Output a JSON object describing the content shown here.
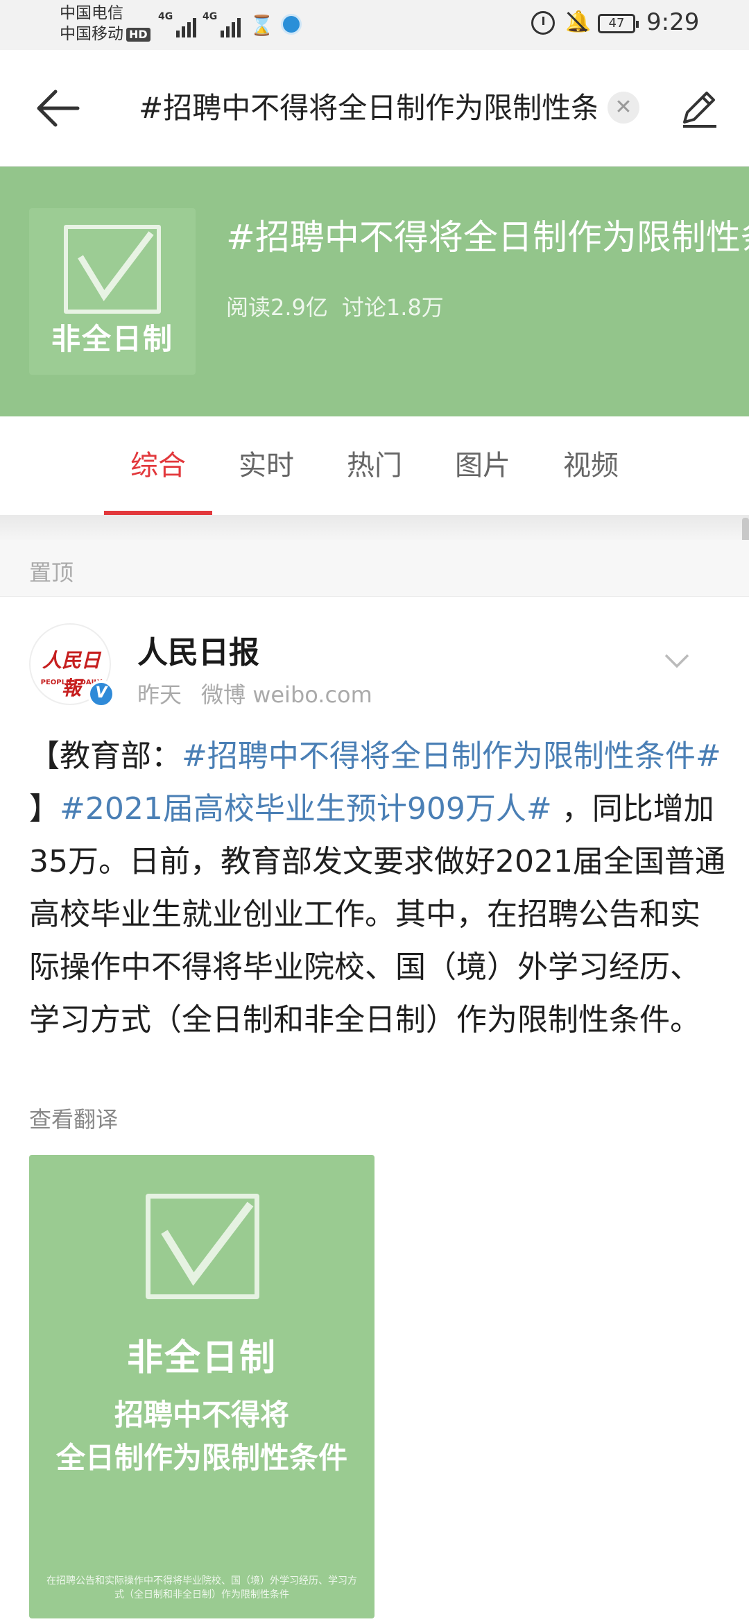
{
  "status_bar": {
    "carrier1": "中国电信",
    "carrier2": "中国移动",
    "hd": "HD",
    "net1": "4G",
    "net2": "4G",
    "battery": "47",
    "time": "9:29"
  },
  "header": {
    "search_query": "#招聘中不得将全日制作为限制性条件#",
    "clear_icon": "close-icon",
    "edit_icon": "pencil-icon",
    "back_icon": "arrow-left-icon"
  },
  "topic": {
    "thumb_label": "非全日制",
    "title": "#招聘中不得将全日制作为限制性条件#",
    "reads": "阅读2.9亿",
    "discussions": "讨论1.8万",
    "banner_color": "#93c58b"
  },
  "tabs": [
    {
      "label": "综合",
      "active": true
    },
    {
      "label": "实时",
      "active": false
    },
    {
      "label": "热门",
      "active": false
    },
    {
      "label": "图片",
      "active": false
    },
    {
      "label": "视频",
      "active": false
    }
  ],
  "accent_color": "#e2383c",
  "pinned_label": "置顶",
  "post": {
    "avatar_logo": "人民日報",
    "avatar_sub": "PEOPLE'S DAILY",
    "verified_badge": "V",
    "author": "人民日报",
    "time": "昨天",
    "source": "微博 weibo.com",
    "body_prefix": "【教育部：",
    "tag1": "#招聘中不得将全日制作为限制性条件#",
    "mid": " 】",
    "tag2": "#2021届高校毕业生预计909万人#",
    "body_rest": " ，同比增加35万。日前，教育部发文要求做好2021届全国普通高校毕业生就业创业工作。其中，在招聘公告和实际操作中不得将毕业院校、国（境）外学习经历、学习方式（全日制和非全日制）作为限制性条件。",
    "translate": "查看翻译",
    "image": {
      "line1": "非全日制",
      "line2a": "招聘中不得将",
      "line2b": "全日制作为限制性条件",
      "line3": "在招聘公告和实际操作中不得将毕业院校、国（境）外学习经历、学习方式（全日制和非全日制）作为限制性条件"
    }
  }
}
